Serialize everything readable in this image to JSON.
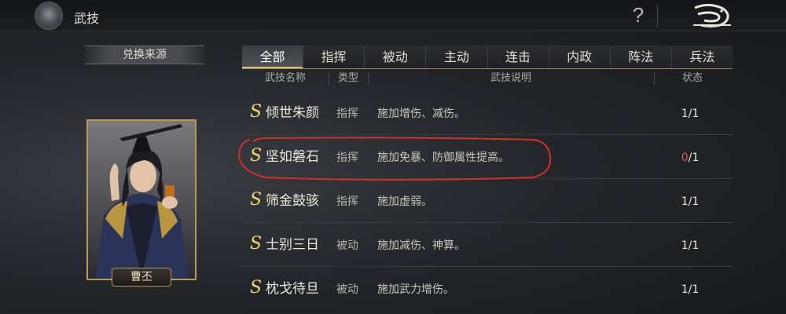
{
  "window": {
    "title": "武技"
  },
  "header": {
    "help_symbol": "?",
    "back_icon": "dragon-back-icon"
  },
  "left_panel": {
    "source_label": "兑换来源",
    "character_name": "曹丕"
  },
  "tabs": [
    {
      "label": "全部",
      "active": true
    },
    {
      "label": "指挥",
      "active": false
    },
    {
      "label": "被动",
      "active": false
    },
    {
      "label": "主动",
      "active": false
    },
    {
      "label": "连击",
      "active": false
    },
    {
      "label": "内政",
      "active": false
    },
    {
      "label": "阵法",
      "active": false
    },
    {
      "label": "兵法",
      "active": false
    }
  ],
  "columns": {
    "name": "武技名称",
    "type": "类型",
    "desc": "武技说明",
    "status": "状态"
  },
  "rows": [
    {
      "grade": "S",
      "name": "倾世朱颜",
      "type": "指挥",
      "desc": "施加增伤、减伤。",
      "status_current": "1",
      "status_total": "/1",
      "status_alert": false
    },
    {
      "grade": "S",
      "name": "坚如磐石",
      "type": "指挥",
      "desc": "施加免暴、防御属性提高。",
      "status_current": "0",
      "status_total": "/1",
      "status_alert": true
    },
    {
      "grade": "S",
      "name": "筛金鼓骇",
      "type": "指挥",
      "desc": "施加虚弱。",
      "status_current": "1",
      "status_total": "/1",
      "status_alert": false
    },
    {
      "grade": "S",
      "name": "士别三日",
      "type": "被动",
      "desc": "施加减伤、神算。",
      "status_current": "1",
      "status_total": "/1",
      "status_alert": false
    },
    {
      "grade": "S",
      "name": "枕戈待旦",
      "type": "被动",
      "desc": "施加武力增伤。",
      "status_current": "1",
      "status_total": "/1",
      "status_alert": false
    }
  ],
  "colors": {
    "grade_gold": "#f0d36a",
    "alert_red": "#e05a4e",
    "annotation_red": "#d0302c",
    "frame_gold": "#b89a55"
  }
}
